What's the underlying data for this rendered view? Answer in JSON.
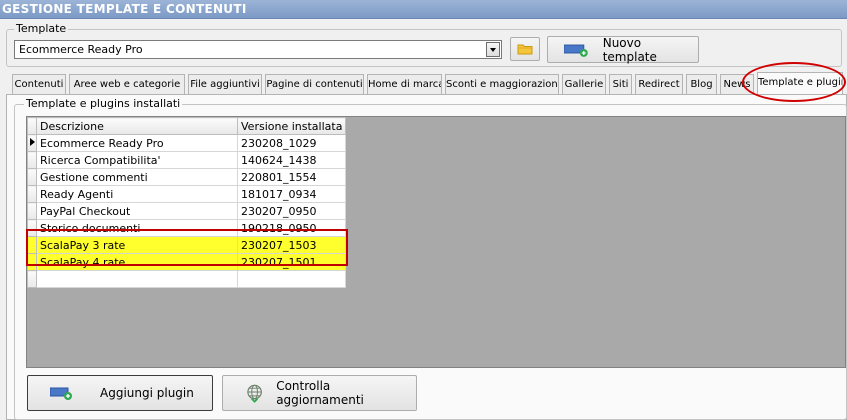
{
  "window": {
    "title": "GESTIONE TEMPLATE E CONTENUTI"
  },
  "template_group": {
    "legend": "Template",
    "selected_value": "Ecommerce Ready Pro",
    "folder_icon": "folder-icon",
    "new_button_label": "Nuovo template",
    "new_button_icon": "add-template-icon"
  },
  "tabs": [
    {
      "label": "Contenuti"
    },
    {
      "label": "Aree web e categorie"
    },
    {
      "label": "File aggiuntivi"
    },
    {
      "label": "Pagine di contenuti"
    },
    {
      "label": "Home di marca"
    },
    {
      "label": "Sconti e maggiorazioni"
    },
    {
      "label": "Gallerie"
    },
    {
      "label": "Siti"
    },
    {
      "label": "Redirect"
    },
    {
      "label": "Blog"
    },
    {
      "label": "News"
    },
    {
      "label": "Template e plugins",
      "active": true
    }
  ],
  "plugins_group": {
    "legend": "Template e plugins installati",
    "columns": [
      "Descrizione",
      "Versione installata"
    ],
    "rows": [
      {
        "descrizione": "Ecommerce Ready Pro",
        "versione": "230208_1029",
        "current": true
      },
      {
        "descrizione": "Ricerca Compatibilita'",
        "versione": "140624_1438"
      },
      {
        "descrizione": "Gestione commenti",
        "versione": "220801_1554"
      },
      {
        "descrizione": "Ready Agenti",
        "versione": "181017_0934"
      },
      {
        "descrizione": "PayPal Checkout",
        "versione": "230207_0950"
      },
      {
        "descrizione": "Storico documenti",
        "versione": "190218_0950"
      },
      {
        "descrizione": "ScalaPay 3 rate",
        "versione": "230207_1503",
        "highlighted": true
      },
      {
        "descrizione": "ScalaPay 4 rate",
        "versione": "230207_1501",
        "highlighted": true
      }
    ]
  },
  "actions": {
    "add_plugin_label": "Aggiungi plugin",
    "check_updates_label": "Controlla aggiornamenti"
  },
  "colors": {
    "highlight_row": "#ffff2e",
    "annotation_red": "#c00000",
    "titlebar": "#7c9ac6"
  }
}
